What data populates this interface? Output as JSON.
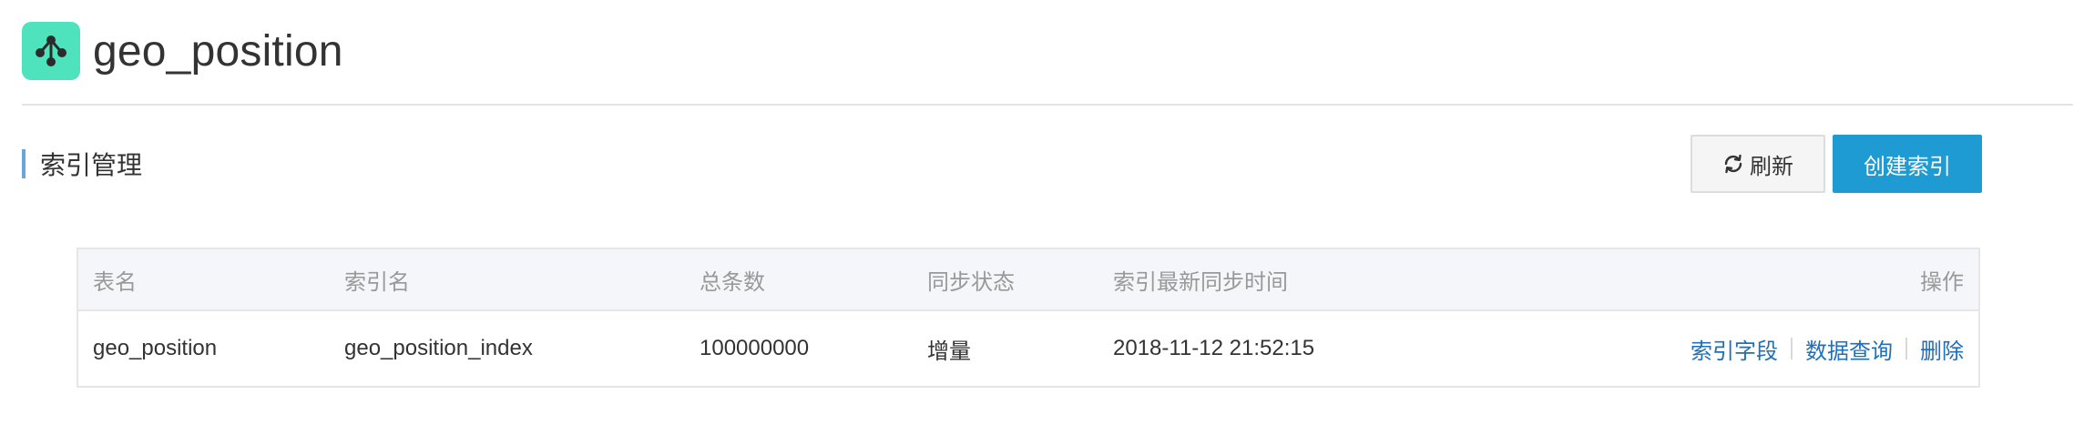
{
  "header": {
    "title": "geo_position",
    "icon": "share-nodes-icon",
    "icon_bg_color": "#4fe3bd"
  },
  "section": {
    "title": "索引管理",
    "accent_color": "#6aa6d6"
  },
  "toolbar": {
    "refresh_label": "刷新",
    "create_label": "创建索引",
    "create_color": "#1f9bd4"
  },
  "table": {
    "columns": [
      "表名",
      "索引名",
      "总条数",
      "同步状态",
      "索引最新同步时间",
      "操作"
    ],
    "rows": [
      {
        "table_name": "geo_position",
        "index_name": "geo_position_index",
        "total_count": "100000000",
        "sync_status": "增量",
        "last_sync_time": "2018-11-12 21:52:15",
        "actions": [
          "索引字段",
          "数据查询",
          "删除"
        ]
      }
    ]
  }
}
